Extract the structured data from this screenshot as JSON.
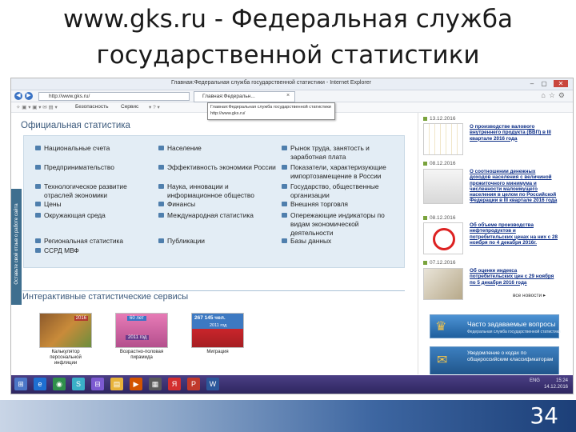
{
  "slide": {
    "title_line1": "www.gks.ru - Федеральная служба",
    "title_line2": "государственной статистики",
    "page_number": "34"
  },
  "browser": {
    "window_title": "Главная:Федеральная служба государственной статистики - Internet Explorer",
    "address": "http://www.gks.ru/",
    "tab_label": "Главная:Федеральн...",
    "tooltip_line1": "Главная:Федеральная служба государственной статистики",
    "tooltip_line2": "http://www.gks.ru/",
    "cmd_security": "Безопасность",
    "cmd_service": "Сервис"
  },
  "page": {
    "official_stats_title": "Официальная статистика",
    "feedback_tab": "Оставьте свой отзыв о работе сайта",
    "stats_col1": [
      "Национальные счета",
      "Предпринимательство",
      "Технологическое развитие отраслей экономики",
      "Цены",
      "Окружающая среда",
      "Региональная статистика",
      "ССРД МВФ"
    ],
    "stats_col2": [
      "Население",
      "Эффективность экономики России",
      "Наука, инновации и информационное общество",
      "Финансы",
      "Международная статистика",
      "Публикации"
    ],
    "stats_col3": [
      "Рынок труда, занятость и заработная плата",
      "Показатели, характеризующие импортозамещение в России",
      "Государство, общественные организации",
      "Внешняя торговля",
      "Опережающие индикаторы по видам экономической деятельности",
      "Базы данных"
    ],
    "interactive_title": "Интерактивные статистические сервисы",
    "services": [
      {
        "caption": "Калькулятор персональной инфляции",
        "badge": "2016"
      },
      {
        "caption": "Возрастно-половая пирамида",
        "badge_top": "60 лет",
        "badge_mid": "2011 год"
      },
      {
        "caption": "Миграция",
        "badge_top": "267 145 чел.",
        "badge_mid": "2011 год"
      }
    ],
    "news": [
      {
        "date": "13.12.2016",
        "text": "О производстве валового внутреннего продукта (ВВП) в III квартале 2016 года"
      },
      {
        "date": "08.12.2016",
        "text": "О соотношении денежных доходов населения с величиной прожиточного минимума и численности малоимущего населения в целом по Российской Федерации в III квартале 2016 года"
      },
      {
        "date": "08.12.2016",
        "text": "Об объеме производства нефтепродуктов и потребительских ценах на них с 28 ноября по 4 декабря 2016г."
      },
      {
        "date": "07.12.2016",
        "text": "Об оценке индекса потребительских цен с 29 ноября по 5 декабря 2016 года"
      }
    ],
    "all_news": "все новости",
    "faq_banner": "Часто задаваемые вопросы",
    "faq_sub": "Федеральная служба государственной статистики",
    "classifier_banner": "Уведомление о кодах по общероссийским классификаторам"
  },
  "taskbar": {
    "time": "15:24",
    "date": "14.12.2016",
    "lang": "ENG"
  },
  "colors": {
    "accent": "#3c5a7c",
    "news_link": "#0a2c86",
    "panel_bg": "#e3edf5",
    "taskbar": "#2e2660"
  }
}
